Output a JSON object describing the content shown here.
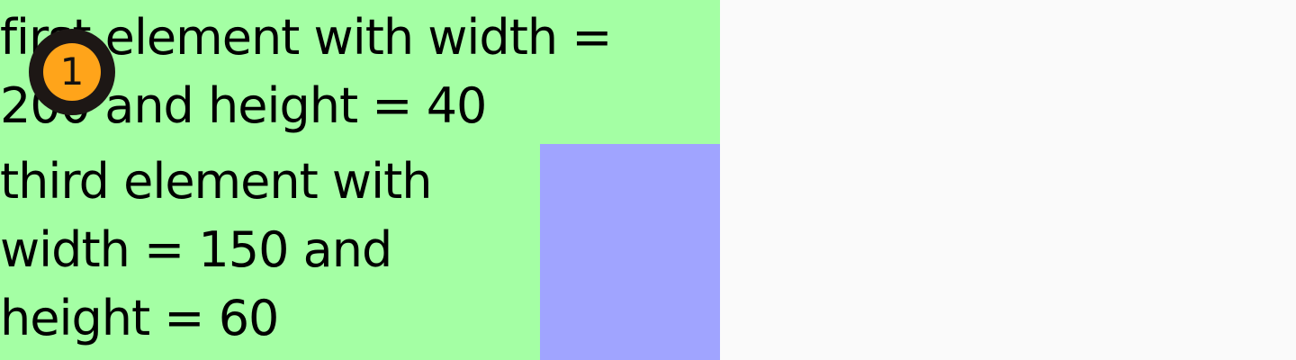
{
  "blocks": {
    "first": {
      "text": "first element with width = 200 and height = 40"
    },
    "third": {
      "text": "third element with width = 150 and height = 60"
    }
  },
  "badge": {
    "number": "1"
  },
  "colors": {
    "background": "#fafafa",
    "green": "#a4ffa4",
    "blue": "#a0a4ff",
    "badge_outer": "#1d1715",
    "badge_inner": "#ffa41a"
  }
}
